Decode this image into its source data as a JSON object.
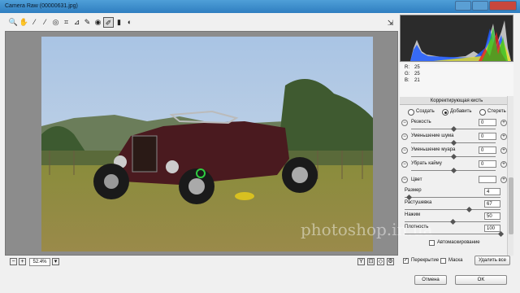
{
  "window": {
    "title": "Camera Raw (00000631.jpg)"
  },
  "toolbar": {
    "tools": [
      {
        "name": "zoom-tool-icon",
        "glyph": "🔍"
      },
      {
        "name": "hand-tool-icon",
        "glyph": "✋"
      },
      {
        "name": "white-balance-icon",
        "glyph": "⁄"
      },
      {
        "name": "color-sampler-icon",
        "glyph": "⁄"
      },
      {
        "name": "target-adjust-icon",
        "glyph": "◎"
      },
      {
        "name": "crop-icon",
        "glyph": "⌗"
      },
      {
        "name": "straighten-icon",
        "glyph": "⊿"
      },
      {
        "name": "spot-removal-icon",
        "glyph": "✎"
      },
      {
        "name": "red-eye-icon",
        "glyph": "◉"
      },
      {
        "name": "adjustment-brush-icon",
        "glyph": "✐"
      },
      {
        "name": "graduated-filter-icon",
        "glyph": "▮"
      },
      {
        "name": "rotate-icon",
        "glyph": "◐"
      }
    ]
  },
  "rgb": {
    "r_label": "R:",
    "r_value": "25",
    "g_label": "G:",
    "g_value": "25",
    "b_label": "B:",
    "b_value": "21"
  },
  "panel": {
    "title": "Корректирующая кисть",
    "modes": {
      "create": "Создать",
      "add": "Добавить",
      "erase": "Стереть",
      "selected": "add"
    },
    "sliders": [
      {
        "label": "Резкость",
        "value": "0",
        "position": 0.5
      },
      {
        "label": "Уменьшение шума",
        "value": "0",
        "position": 0.5
      },
      {
        "label": "Уменьшение муара",
        "value": "0",
        "position": 0.5
      },
      {
        "label": "Убрать кайму",
        "value": "0",
        "position": 0.5
      }
    ],
    "color_label": "Цвет",
    "brush": [
      {
        "label": "Размер",
        "value": "4",
        "position": 0.04
      },
      {
        "label": "Растушевка",
        "value": "67",
        "position": 0.67
      },
      {
        "label": "Нажим",
        "value": "50",
        "position": 0.5
      },
      {
        "label": "Плотность",
        "value": "100",
        "position": 1.0
      }
    ],
    "automask_label": "Автомаскирование",
    "overlay_label": "Перекрытие",
    "mask_label": "Маска",
    "clear_all_label": "Удалить все"
  },
  "status": {
    "zoom": "52.4%"
  },
  "buttons": {
    "cancel": "Отмена",
    "ok": "OK"
  },
  "watermark": "photoshop.in.ua"
}
